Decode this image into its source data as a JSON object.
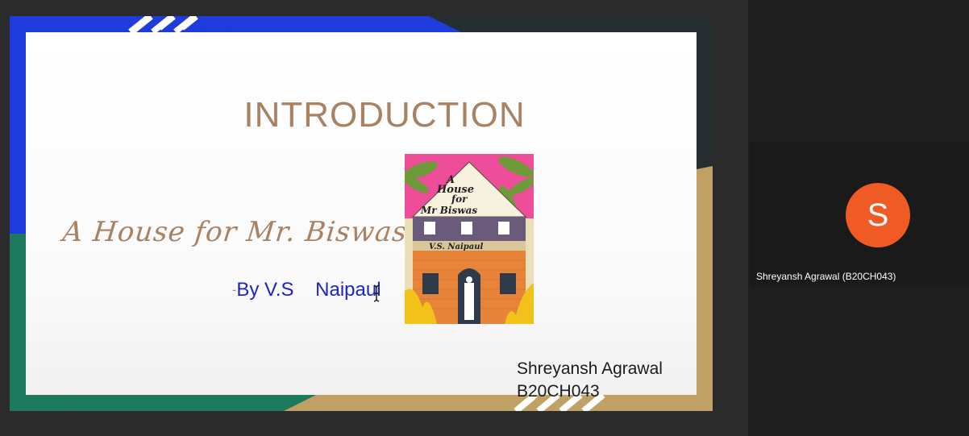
{
  "colors": {
    "accent_blue": "#1f3bdc",
    "accent_green": "#1d7a5e",
    "accent_gold": "#bfa065",
    "title_brown": "#a88262",
    "byline_blue": "#1a24c9",
    "avatar_orange": "#f05a24"
  },
  "slide": {
    "title": "INTRODUCTION",
    "book_title": "A House for Mr. Biswas",
    "byline_prefix": "-",
    "byline": "By V.S    Naipaul",
    "presenter_name": "Shreyansh Agrawal",
    "presenter_id": "B20CH043",
    "book_cover": {
      "title_line1": "A",
      "title_line2": "House",
      "title_line3": "for",
      "title_line4": "Mr Biswas",
      "author": "V.S. Naipaul"
    }
  },
  "participant": {
    "initial": "S",
    "name": "Shreyansh Agrawal (B20CH043)"
  },
  "icons": {
    "cursor": "text-cursor-icon"
  }
}
